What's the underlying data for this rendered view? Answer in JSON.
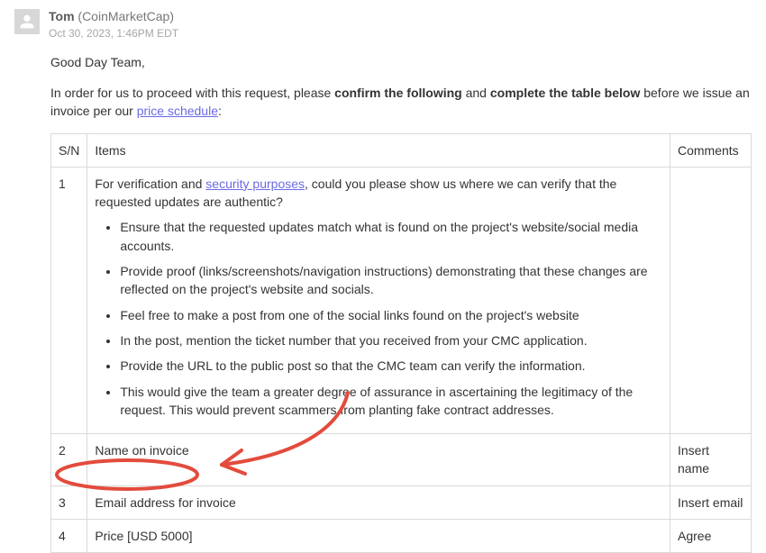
{
  "header": {
    "sender_name": "Tom",
    "sender_org": "(CoinMarketCap)",
    "sent_at": "Oct 30, 2023, 1:46PM EDT"
  },
  "body": {
    "greeting": "Good Day Team,",
    "intro_pre": "In order for us to proceed with this request, please ",
    "intro_bold1": "confirm the following",
    "intro_mid": " and ",
    "intro_bold2": "complete the table below",
    "intro_post": " before we issue an invoice per our ",
    "intro_link": "price schedule",
    "intro_end": ":"
  },
  "table": {
    "headers": {
      "sn": "S/N",
      "items": "Items",
      "comments": "Comments"
    },
    "rows": [
      {
        "sn": "1",
        "lead_pre": "For verification and ",
        "lead_link": "security purposes",
        "lead_post": ", could you please show us where we can verify that the requested updates are authentic?",
        "bullets": [
          "Ensure that the requested updates match what is found on the project's website/social media accounts.",
          "Provide proof (links/screenshots/navigation instructions) demonstrating that these changes are reflected on the project's website and socials.",
          "Feel free to make a post from one of the social links found on the project's website",
          "In the post, mention the ticket number that you received from your CMC application.",
          "Provide the URL to the public post so that the CMC team can verify the information.",
          "This would give the team a greater degree of assurance in ascertaining the legitimacy of the request. This would prevent scammers from planting fake contract addresses."
        ],
        "comments": ""
      },
      {
        "sn": "2",
        "item": "Name on invoice",
        "comments": "Insert name"
      },
      {
        "sn": "3",
        "item": "Email address for invoice",
        "comments": "Insert email"
      },
      {
        "sn": "4",
        "item": "Price [USD 5000]",
        "comments": "Agree"
      }
    ]
  }
}
